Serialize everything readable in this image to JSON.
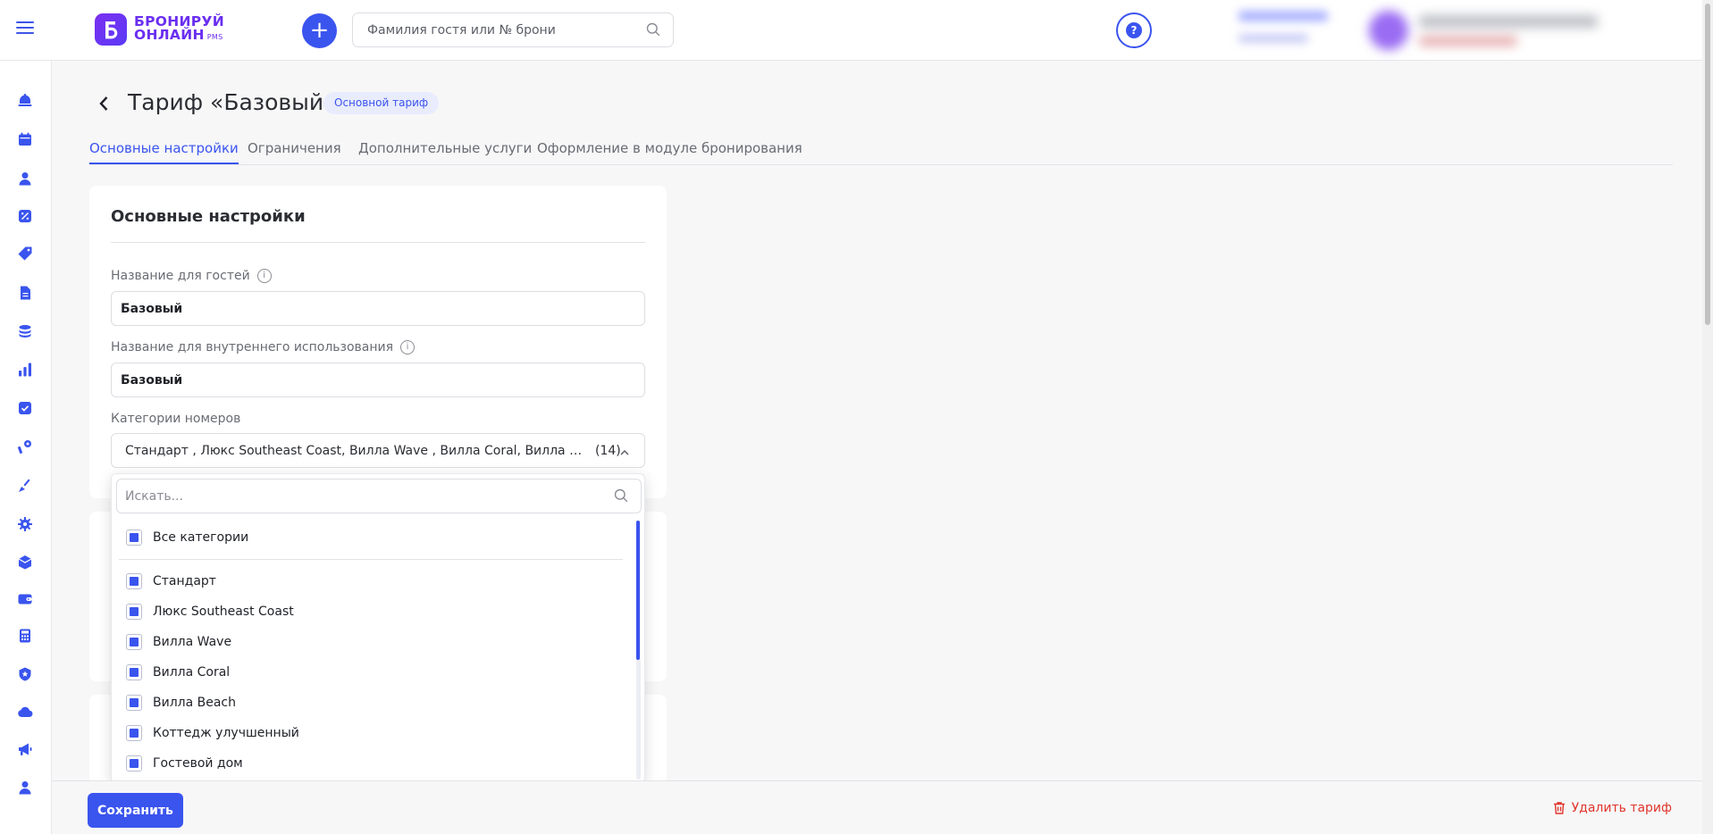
{
  "header": {
    "logo_line1": "БРОНИРУЙ",
    "logo_line2": "ОНЛАЙН",
    "logo_suffix": "PMS",
    "add_label": "+",
    "search_placeholder": "Фамилия гостя или № брони",
    "help_label": "?"
  },
  "sidebar": {
    "items": [
      "reception",
      "calendar",
      "guests",
      "discounts",
      "tariffs",
      "documents",
      "finance",
      "reports",
      "tasks",
      "services",
      "housekeeping",
      "settings",
      "inventory",
      "wallet",
      "calculator",
      "security",
      "cloud",
      "marketing",
      "profile"
    ]
  },
  "page": {
    "title": "Тариф «Базовый»",
    "badge": "Основной тариф"
  },
  "tabs": [
    {
      "label": "Основные настройки",
      "active": true
    },
    {
      "label": "Ограничения",
      "active": false
    },
    {
      "label": "Дополнительные услуги",
      "active": false
    },
    {
      "label": "Оформление в модуле бронирования",
      "active": false
    }
  ],
  "card": {
    "title": "Основные настройки",
    "guest_name_label": "Название для гостей",
    "guest_name_value": "Базовый",
    "internal_name_label": "Название для внутреннего использования",
    "internal_name_value": "Базовый",
    "categories_label": "Категории номеров",
    "categories_value": "Стандарт , Люкс Southeast Coast, Вилла Wave , Вилла Coral, Вилла Beach, ...",
    "categories_count": "(14)"
  },
  "dropdown": {
    "search_placeholder": "Искать...",
    "all_label": "Все категории",
    "items": [
      "Стандарт",
      "Люкс Southeast Coast",
      "Вилла Wave",
      "Вилла Coral",
      "Вилла Beach",
      "Коттедж улучшенный",
      "Гостевой дом"
    ]
  },
  "footer": {
    "save_label": "Сохранить",
    "delete_label": "Удалить тариф"
  },
  "colors": {
    "accent": "#3a54ee",
    "danger": "#e0352b",
    "logo": "#6a2ef0"
  }
}
